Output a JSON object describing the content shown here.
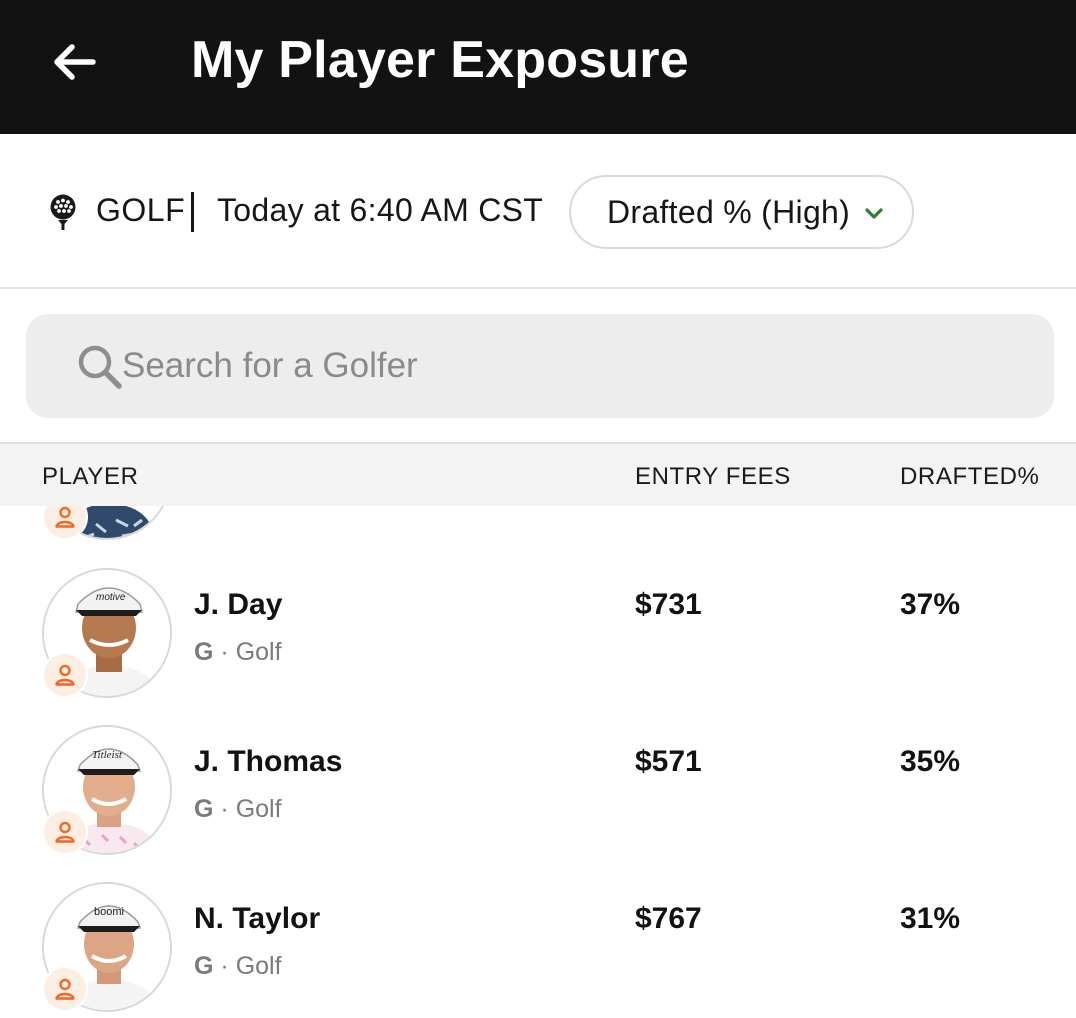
{
  "header": {
    "title": "My Player Exposure",
    "back_icon": "back-arrow-icon"
  },
  "filters": {
    "sport_icon": "golf-ball-tee-icon",
    "sport": "GOLF",
    "time": "Today at 6:40 AM CST",
    "sort_label": "Drafted % (High)",
    "sort_icon": "chevron-down-icon",
    "accent_color": "#2e7d32"
  },
  "search": {
    "placeholder": "Search for a Golfer",
    "value": ""
  },
  "table": {
    "columns": [
      "PLAYER",
      "ENTRY FEES",
      "DRAFTED%"
    ],
    "badge_color": "#f26722",
    "rows": [
      {
        "name": "",
        "position": "",
        "sport": "",
        "fee": "",
        "drafted": ""
      },
      {
        "name": "J. Day",
        "position": "G",
        "sport": "Golf",
        "fee": "$731",
        "drafted": "37%"
      },
      {
        "name": "J. Thomas",
        "position": "G",
        "sport": "Golf",
        "fee": "$571",
        "drafted": "35%"
      },
      {
        "name": "N. Taylor",
        "position": "G",
        "sport": "Golf",
        "fee": "$767",
        "drafted": "31%"
      }
    ]
  }
}
